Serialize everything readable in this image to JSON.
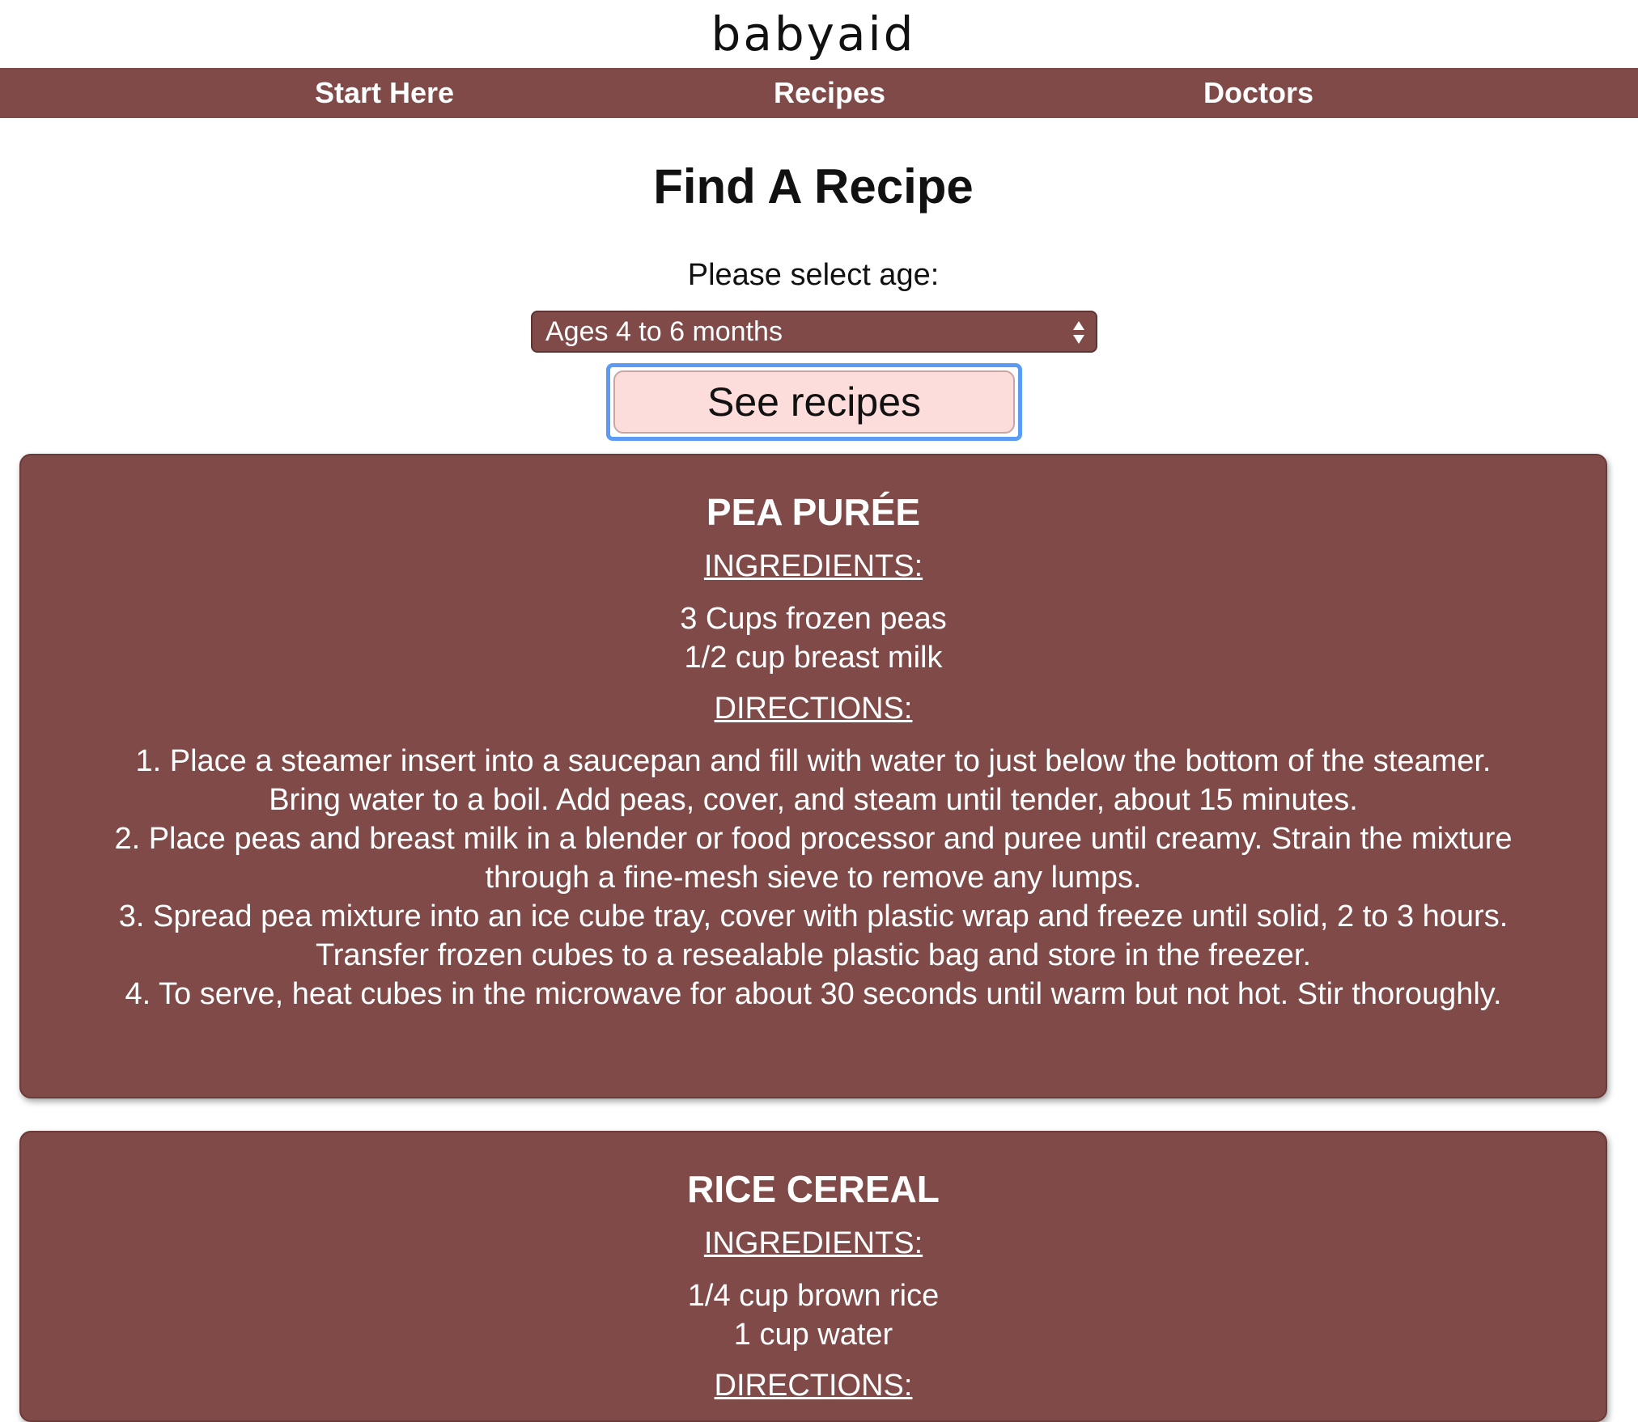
{
  "site": {
    "logo_text": "babyaid"
  },
  "nav": {
    "items": [
      {
        "label": "Start Here"
      },
      {
        "label": "Recipes"
      },
      {
        "label": "Doctors"
      }
    ]
  },
  "main": {
    "title": "Find A Recipe",
    "age_label": "Please select age:",
    "age_select_value": "Ages 4 to 6 months",
    "see_recipes_button": "See recipes"
  },
  "recipes": [
    {
      "title": "PEA PURÉE",
      "ingredients_heading": "INGREDIENTS:",
      "ingredients": [
        "3 Cups frozen peas",
        "1/2 cup breast milk"
      ],
      "directions_heading": "DIRECTIONS:",
      "directions": [
        "1. Place a steamer insert into a saucepan and fill with water to just below the bottom of the steamer. Bring water to a boil. Add peas, cover, and steam until tender, about 15 minutes.",
        "2. Place peas and breast milk in a blender or food processor and puree until creamy. Strain the mixture through a fine-mesh sieve to remove any lumps.",
        "3. Spread pea mixture into an ice cube tray, cover with plastic wrap and freeze until solid, 2 to 3 hours. Transfer frozen cubes to a resealable plastic bag and store in the freezer.",
        "4. To serve, heat cubes in the microwave for about 30 seconds until warm but not hot. Stir thoroughly."
      ]
    },
    {
      "title": "RICE CEREAL",
      "ingredients_heading": "INGREDIENTS:",
      "ingredients": [
        "1/4 cup brown rice",
        "1 cup water"
      ],
      "directions_heading": "DIRECTIONS:"
    }
  ],
  "colors": {
    "brand": "#7f4a48",
    "button_bg": "#fddcdc",
    "focus_ring": "#5b9bf3"
  }
}
